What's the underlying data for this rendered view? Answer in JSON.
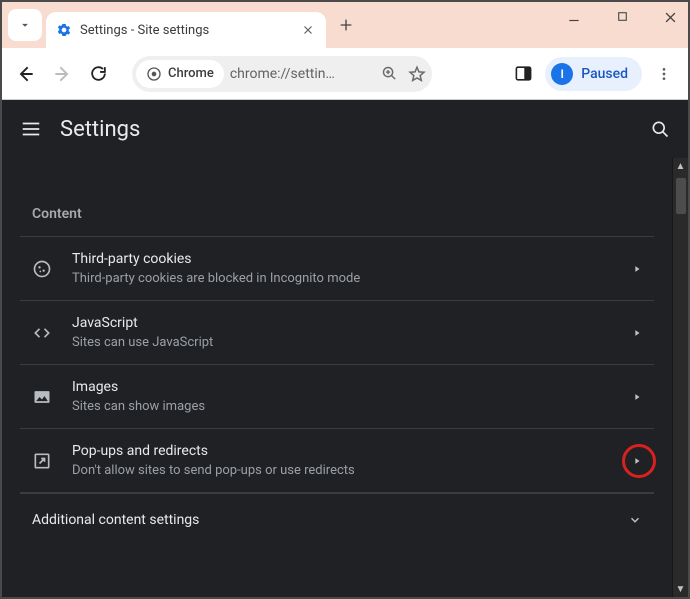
{
  "tab": {
    "title": "Settings - Site settings"
  },
  "toolbar": {
    "chip": "Chrome",
    "url": "chrome://settin…",
    "paused": "Paused",
    "avatarLetter": "I"
  },
  "settings": {
    "title": "Settings"
  },
  "content": {
    "section": "Content",
    "rows": [
      {
        "title": "Third-party cookies",
        "sub": "Third-party cookies are blocked in Incognito mode"
      },
      {
        "title": "JavaScript",
        "sub": "Sites can use JavaScript"
      },
      {
        "title": "Images",
        "sub": "Sites can show images"
      },
      {
        "title": "Pop-ups and redirects",
        "sub": "Don't allow sites to send pop-ups or use redirects"
      }
    ],
    "expand": "Additional content settings"
  }
}
